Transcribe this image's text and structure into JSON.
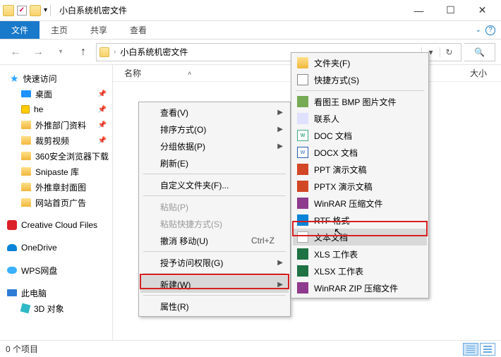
{
  "window": {
    "title": "小白系统机密文件"
  },
  "ribbon": {
    "file": "文件",
    "tabs": [
      "主页",
      "共享",
      "查看"
    ]
  },
  "address": {
    "crumb": "小白系统机密文件"
  },
  "columns": {
    "name": "名称",
    "size": "大小"
  },
  "sidebar": {
    "quick_access": "快速访问",
    "items": [
      {
        "label": "桌面"
      },
      {
        "label": "he"
      },
      {
        "label": "外推部门资料"
      },
      {
        "label": "裁剪视频"
      },
      {
        "label": "360安全浏览器下载"
      },
      {
        "label": "Snipaste 库"
      },
      {
        "label": "外推章封面图"
      },
      {
        "label": "网站首页广告"
      }
    ],
    "creative_cloud": "Creative Cloud Files",
    "onedrive": "OneDrive",
    "wps": "WPS网盘",
    "this_pc": "此电脑",
    "obj3d": "3D 对象"
  },
  "status": {
    "items": "0 个项目"
  },
  "context_menu": {
    "view": "查看(V)",
    "sort": "排序方式(O)",
    "group": "分组依据(P)",
    "refresh": "刷新(E)",
    "customize": "自定义文件夹(F)...",
    "paste": "粘贴(P)",
    "paste_shortcut": "粘贴快捷方式(S)",
    "undo": "撤消 移动(U)",
    "undo_key": "Ctrl+Z",
    "grant_access": "授予访问权限(G)",
    "new": "新建(W)",
    "properties": "属性(R)"
  },
  "new_submenu": {
    "folder": "文件夹(F)",
    "shortcut": "快捷方式(S)",
    "bmp": "看图王 BMP 图片文件",
    "contact": "联系人",
    "doc": "DOC 文档",
    "docx": "DOCX 文档",
    "ppt": "PPT 演示文稿",
    "pptx": "PPTX 演示文稿",
    "rar": "WinRAR 压缩文件",
    "rtf": "RTF 格式",
    "txt": "文本文档",
    "xls": "XLS 工作表",
    "xlsx": "XLSX 工作表",
    "zip": "WinRAR ZIP 压缩文件"
  }
}
